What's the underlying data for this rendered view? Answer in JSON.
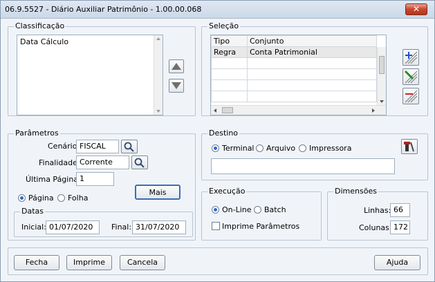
{
  "window": {
    "title": "06.9.5527 - Diário Auxiliar Patrimônio - 1.00.00.068",
    "close_glyph": "✕"
  },
  "classificacao": {
    "label": "Classificação",
    "items": [
      "Data Cálculo"
    ]
  },
  "selecao": {
    "label": "Seleção",
    "columns": [
      "Tipo",
      "Conjunto"
    ],
    "rows": [
      [
        "Regra",
        "Conta Patrimonial"
      ]
    ]
  },
  "parametros": {
    "label": "Parâmetros",
    "cenario_label": "Cenário:",
    "cenario_value": "FISCAL",
    "finalidade_label": "Finalidade:",
    "finalidade_value": "Corrente",
    "ultima_label": "Última Página:",
    "ultima_value": "1",
    "mais_label": "Mais",
    "pagina_label": "Página",
    "folha_label": "Folha",
    "datas": {
      "label": "Datas",
      "inicial_label": "Inicial:",
      "inicial_value": "01/07/2020",
      "final_label": "Final:",
      "final_value": "31/07/2020"
    }
  },
  "destino": {
    "label": "Destino",
    "terminal": "Terminal",
    "arquivo": "Arquivo",
    "impressora": "Impressora"
  },
  "execucao": {
    "label": "Execução",
    "online": "On-Line",
    "batch": "Batch",
    "imprime": "Imprime Parâmetros"
  },
  "dimensoes": {
    "label": "Dimensões",
    "linhas_label": "Linhas:",
    "linhas_value": "66",
    "colunas_label": "Colunas:",
    "colunas_value": "172"
  },
  "footer": {
    "fecha": "Fecha",
    "imprime": "Imprime",
    "cancela": "Cancela",
    "ajuda": "Ajuda"
  },
  "colors": {
    "accent": "#2a6bd1",
    "add": "#1f4fd0",
    "remove": "#d02020"
  }
}
